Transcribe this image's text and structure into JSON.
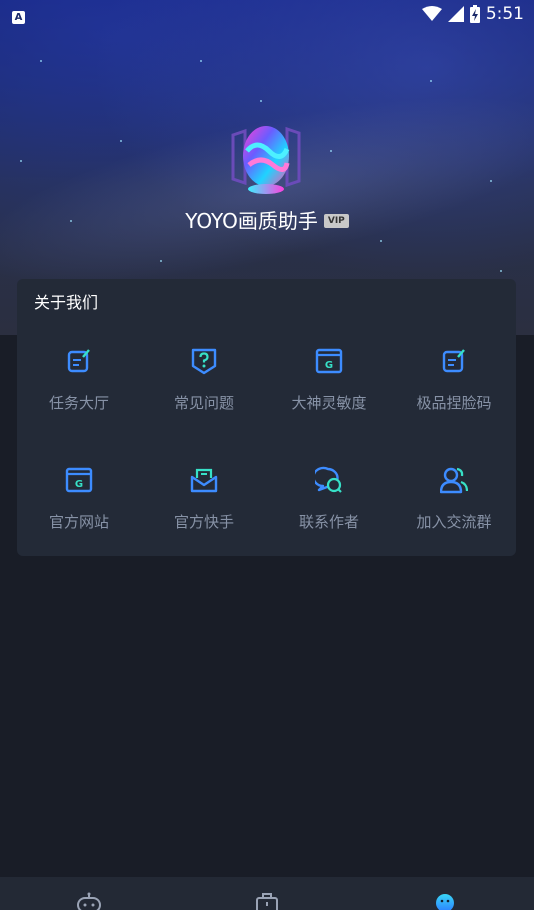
{
  "status_bar": {
    "notification_icon": "a-letter-icon",
    "time": "5:51"
  },
  "profile": {
    "app_name": "YOYO画质助手",
    "badge": "VIP"
  },
  "about": {
    "title": "关于我们",
    "items": [
      {
        "label": "任务大厅",
        "icon": "task-icon"
      },
      {
        "label": "常见问题",
        "icon": "question-shield-icon"
      },
      {
        "label": "大神灵敏度",
        "icon": "g-window-icon"
      },
      {
        "label": "极品捏脸码",
        "icon": "edit-note-icon"
      },
      {
        "label": "官方网站",
        "icon": "g-window-icon"
      },
      {
        "label": "官方快手",
        "icon": "inbox-icon"
      },
      {
        "label": "联系作者",
        "icon": "chat-bubbles-icon"
      },
      {
        "label": "加入交流群",
        "icon": "group-users-icon"
      }
    ]
  },
  "bottom_nav": [
    {
      "icon": "gamepad-icon",
      "active": false
    },
    {
      "icon": "toolbox-icon",
      "active": false
    },
    {
      "icon": "robot-profile-icon",
      "active": true
    }
  ],
  "colors": {
    "accent_icon": "#3d8cff",
    "background": "#191d27",
    "card": "#232a37",
    "label_gray": "#8792a6"
  }
}
